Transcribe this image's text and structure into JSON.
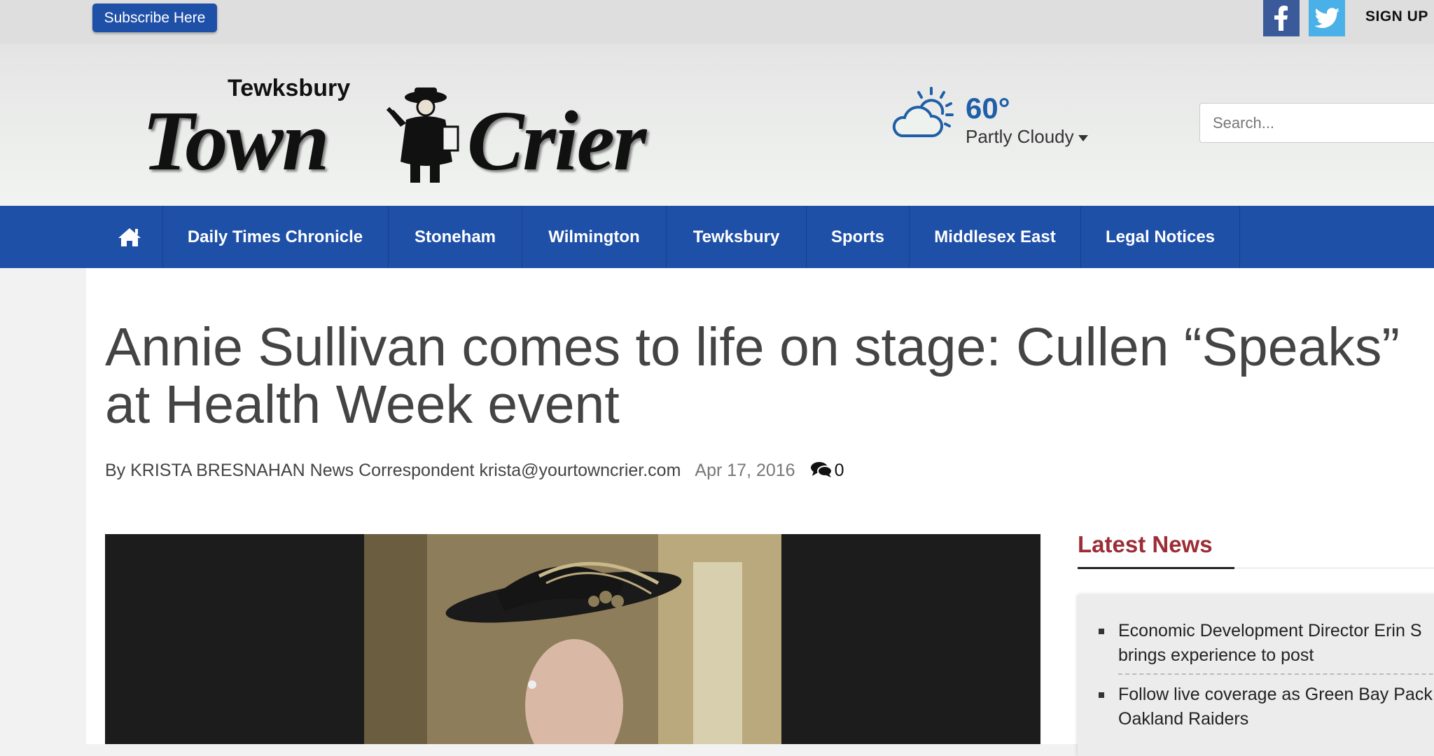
{
  "topbar": {
    "subscribe_label": "Subscribe Here",
    "facebook_icon": "facebook-icon",
    "twitter_icon": "twitter-icon",
    "signup_label": "SIGN UP",
    "colors": {
      "facebook": "#3b5a9a",
      "twitter": "#4ab1e8",
      "subscribe": "#1f50a8"
    }
  },
  "masthead": {
    "logo": {
      "town": "Tewksbury",
      "word1": "Town",
      "word2": "Crier"
    },
    "weather": {
      "icon": "partly-cloudy-icon",
      "temp": "60°",
      "condition": "Partly Cloudy"
    },
    "search": {
      "placeholder": "Search..."
    }
  },
  "nav": {
    "home_icon": "home-icon",
    "items": [
      {
        "label": "Daily Times Chronicle"
      },
      {
        "label": "Stoneham"
      },
      {
        "label": "Wilmington"
      },
      {
        "label": "Tewksbury"
      },
      {
        "label": "Sports"
      },
      {
        "label": "Middlesex East"
      },
      {
        "label": "Legal Notices"
      }
    ],
    "color": "#1f50a8"
  },
  "article": {
    "headline": "Annie Sullivan comes to life on stage: Cullen “Speaks” at Health Week event",
    "byline": "By KRISTA BRESNAHAN News Correspondent krista@yourtowncrier.com",
    "date": "Apr 17, 2016",
    "comment_count": "0"
  },
  "sidebar": {
    "title": "Latest News",
    "title_color": "#9b2d35",
    "news": [
      {
        "line1": "Economic Development Director Erin S",
        "line2": "brings experience to post"
      },
      {
        "line1": "Follow live coverage as Green Bay Pack",
        "line2": "Oakland Raiders"
      }
    ]
  }
}
